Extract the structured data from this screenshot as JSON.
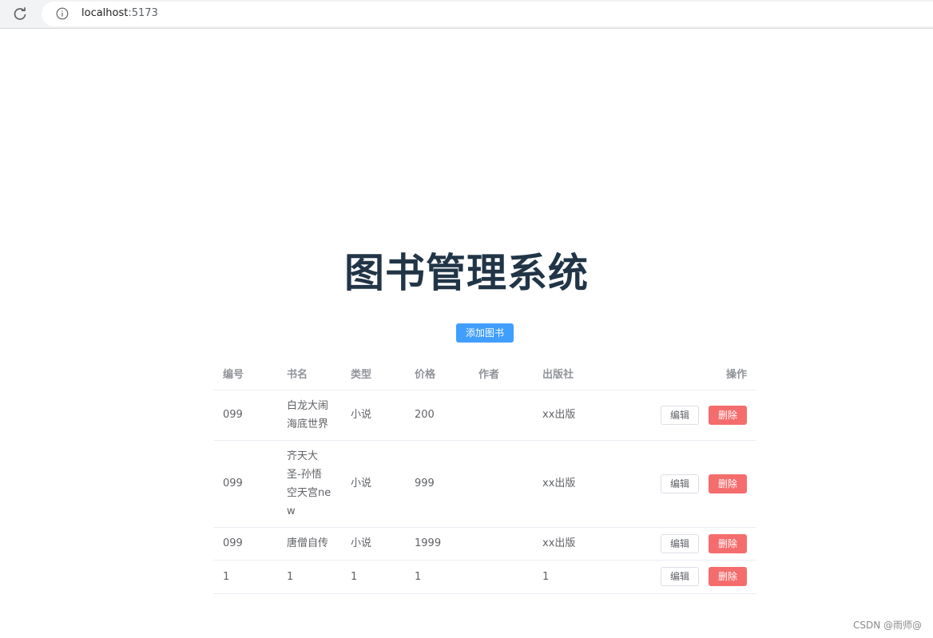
{
  "browser": {
    "url_host": "localhost",
    "url_port": ":5173",
    "reload_icon": "reload-icon",
    "info_icon": "info-icon"
  },
  "page": {
    "title": "图书管理系统",
    "add_button_label": "添加图书"
  },
  "table": {
    "headers": {
      "id": "编号",
      "name": "书名",
      "type": "类型",
      "price": "价格",
      "author": "作者",
      "publisher": "出版社",
      "ops": "操作"
    },
    "rows": [
      {
        "id": "099",
        "name": "白龙大闹海底世界",
        "type": "小说",
        "price": "200",
        "author": "",
        "publisher": "xx出版",
        "edit": "编辑",
        "delete": "删除"
      },
      {
        "id": "099",
        "name": "齐天大圣-孙悟空天宫new",
        "type": "小说",
        "price": "999",
        "author": "",
        "publisher": "xx出版",
        "edit": "编辑",
        "delete": "删除"
      },
      {
        "id": "099",
        "name": "唐僧自传",
        "type": "小说",
        "price": "1999",
        "author": "",
        "publisher": "xx出版",
        "edit": "编辑",
        "delete": "删除"
      },
      {
        "id": "1",
        "name": "1",
        "type": "1",
        "price": "1",
        "author": "",
        "publisher": "1",
        "edit": "编辑",
        "delete": "删除"
      }
    ]
  },
  "watermark": "CSDN @雨师@",
  "colors": {
    "primary": "#409eff",
    "danger": "#f56c6c",
    "title": "#213547"
  }
}
